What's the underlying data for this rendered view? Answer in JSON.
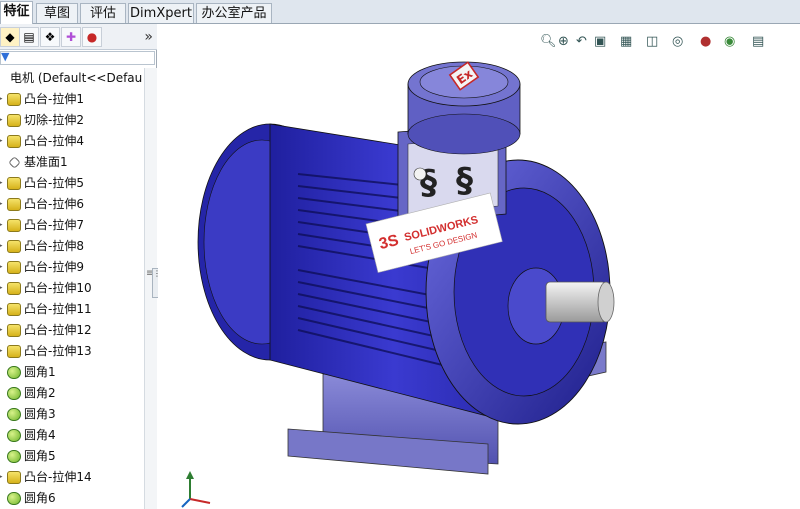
{
  "tabs": [
    "特征",
    "草图",
    "评估",
    "DimXpert",
    "办公室产品"
  ],
  "active_tab": "特征",
  "panel": {
    "toolbar_icons": [
      "feature-manager-icon",
      "property-manager-icon",
      "configuration-manager-icon",
      "dimxpert-manager-icon",
      "display-manager-icon"
    ],
    "more_label": "»",
    "root_label": "电机 (Default<<Defau",
    "items": [
      {
        "label": "凸台-拉伸1",
        "icon": "extrude-icon"
      },
      {
        "label": "切除-拉伸2",
        "icon": "extrude-icon"
      },
      {
        "label": "凸台-拉伸4",
        "icon": "extrude-icon"
      },
      {
        "label": "基准面1",
        "icon": "plane-icon"
      },
      {
        "label": "凸台-拉伸5",
        "icon": "extrude-icon"
      },
      {
        "label": "凸台-拉伸6",
        "icon": "extrude-icon"
      },
      {
        "label": "凸台-拉伸7",
        "icon": "extrude-icon"
      },
      {
        "label": "凸台-拉伸8",
        "icon": "extrude-icon"
      },
      {
        "label": "凸台-拉伸9",
        "icon": "extrude-icon"
      },
      {
        "label": "凸台-拉伸10",
        "icon": "extrude-icon"
      },
      {
        "label": "凸台-拉伸11",
        "icon": "extrude-icon"
      },
      {
        "label": "凸台-拉伸12",
        "icon": "extrude-icon"
      },
      {
        "label": "凸台-拉伸13",
        "icon": "extrude-icon"
      },
      {
        "label": "圆角1",
        "icon": "fillet-icon"
      },
      {
        "label": "圆角2",
        "icon": "fillet-icon"
      },
      {
        "label": "圆角3",
        "icon": "fillet-icon"
      },
      {
        "label": "圆角4",
        "icon": "fillet-icon"
      },
      {
        "label": "圆角5",
        "icon": "fillet-icon"
      },
      {
        "label": "凸台-拉伸14",
        "icon": "extrude-icon"
      },
      {
        "label": "圆角6",
        "icon": "fillet-icon"
      }
    ]
  },
  "viewport": {
    "toolbar_icons": [
      "zoom-to-fit-icon",
      "zoom-to-area-icon",
      "previous-view-icon",
      "section-view-icon",
      "view-orientation-icon",
      "display-style-icon",
      "hide-show-icon",
      "edit-appearance-icon",
      "apply-scene-icon",
      "view-settings-icon"
    ],
    "logo_brand": "SOLIDWORKS",
    "logo_tagline": "LET'S GO DESIGN",
    "model_color": "#3636c8"
  }
}
